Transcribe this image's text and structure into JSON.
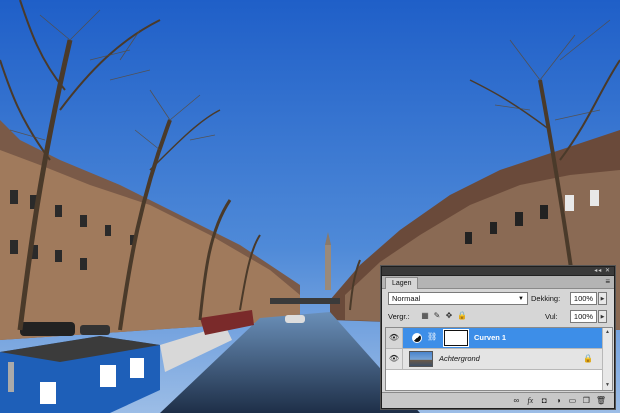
{
  "panel": {
    "tab_label": "Lagen",
    "menu_icon": "panel-menu-icon",
    "blend_mode": "Normaal",
    "opacity_label": "Dekking:",
    "opacity_value": "100%",
    "lock_label": "Vergr.:",
    "fill_label": "Vul:",
    "fill_value": "100%"
  },
  "layers": [
    {
      "name": "Curven 1",
      "selected": true,
      "type": "curves-adjustment"
    },
    {
      "name": "Achtergrond",
      "selected": false,
      "type": "background",
      "locked": true
    }
  ],
  "bottom_icons": [
    "link-icon",
    "fx-icon",
    "mask-icon",
    "adjustment-icon",
    "group-icon",
    "new-layer-icon",
    "trash-icon"
  ],
  "colors": {
    "selection": "#3d8ee8",
    "panel_bg": "#d6d6d6",
    "sky": "#2f6fd0"
  }
}
